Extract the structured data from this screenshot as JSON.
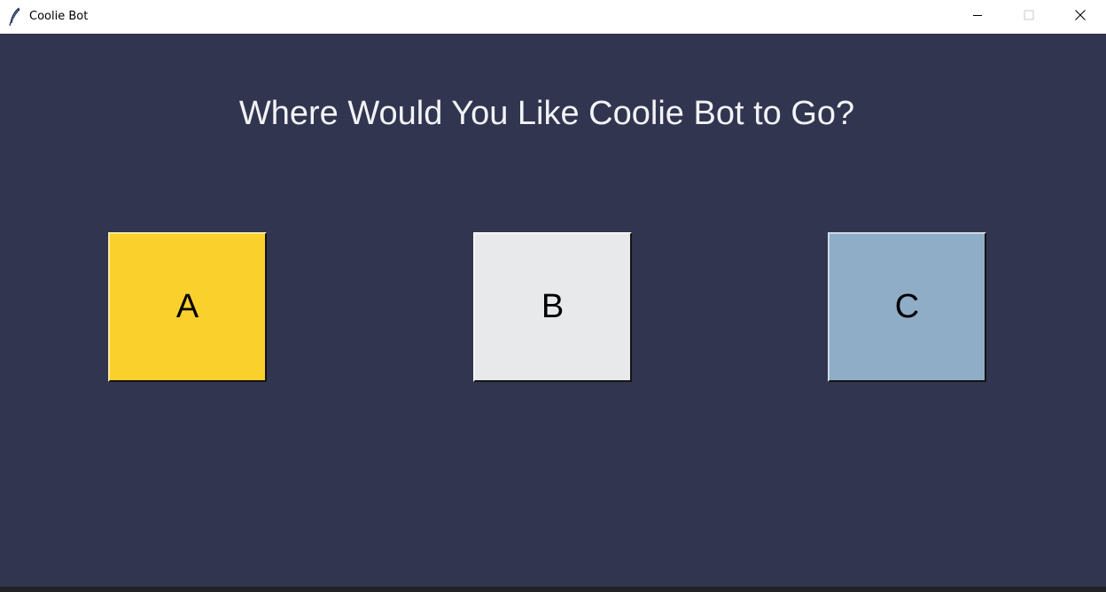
{
  "window": {
    "title": "Coolie Bot",
    "icon": "feather-icon",
    "controls": {
      "minimize": "minimize-icon",
      "maximize": "maximize-icon",
      "close": "close-icon"
    }
  },
  "main": {
    "heading": "Where Would You Like Coolie Bot to Go?",
    "background_color": "#32354f",
    "heading_color": "#f2f3f7",
    "destinations": [
      {
        "label": "A",
        "color": "#fad02c"
      },
      {
        "label": "B",
        "color": "#e8e9eb"
      },
      {
        "label": "C",
        "color": "#8fadc6"
      }
    ]
  }
}
